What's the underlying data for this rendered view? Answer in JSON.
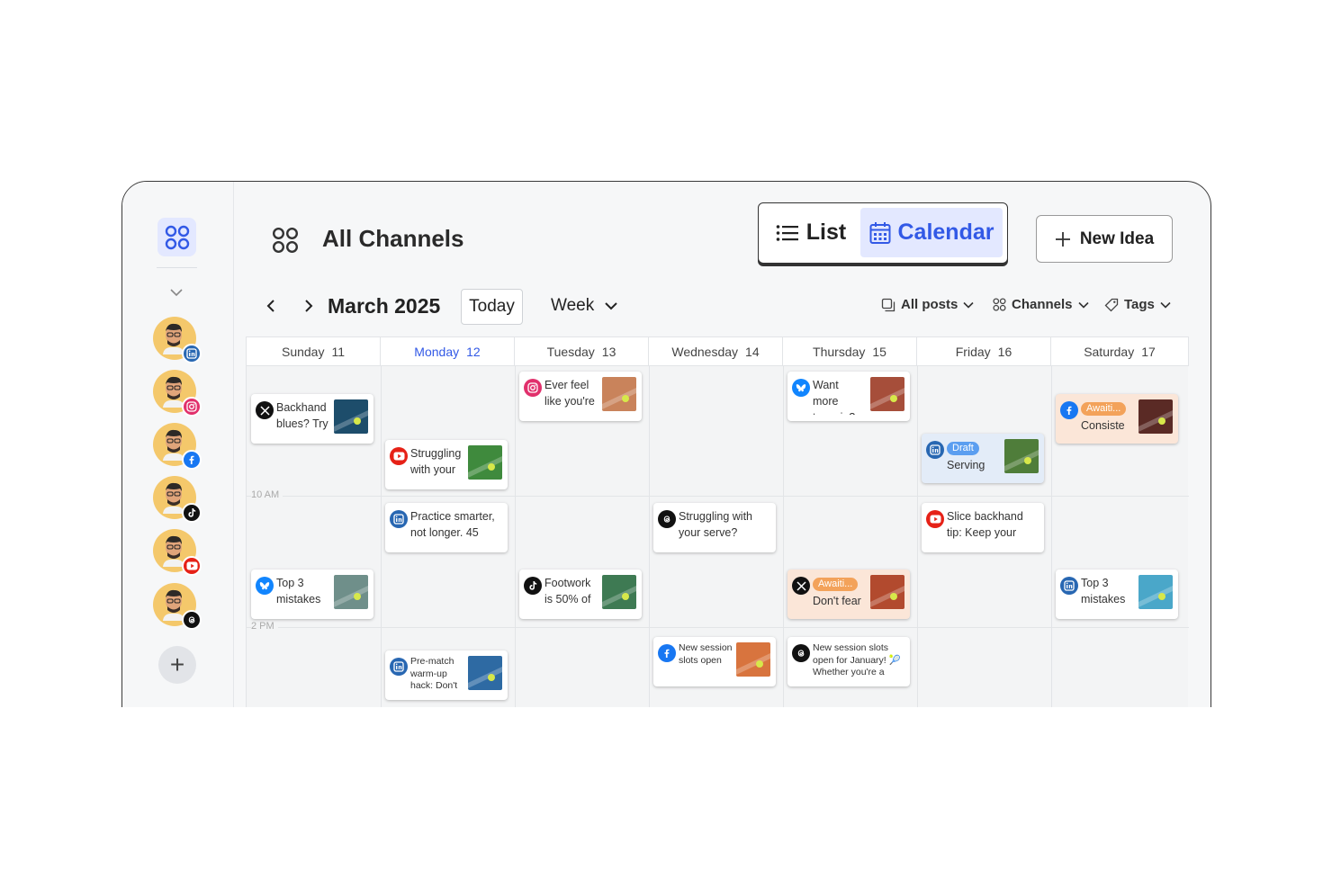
{
  "colors": {
    "accent": "#3259e6",
    "linkedin": "#2867b2",
    "instagram": "#e1306c",
    "facebook": "#1877f2",
    "tiktok": "#111111",
    "youtube": "#e62117",
    "threads": "#111111",
    "bluesky": "#1185fe",
    "x": "#111111"
  },
  "sidebar": {
    "grid_icon": "grid-icon",
    "collapse_icon": "chevron-down-icon",
    "accounts": [
      {
        "network": "linkedin",
        "badge_icon": "linkedin-icon"
      },
      {
        "network": "instagram",
        "badge_icon": "instagram-icon"
      },
      {
        "network": "facebook",
        "badge_icon": "facebook-icon"
      },
      {
        "network": "tiktok",
        "badge_icon": "tiktok-icon"
      },
      {
        "network": "youtube",
        "badge_icon": "youtube-icon"
      },
      {
        "network": "threads",
        "badge_icon": "threads-icon"
      }
    ],
    "add_label": "+"
  },
  "header": {
    "title": "All Channels",
    "view_list_label": "List",
    "view_calendar_label": "Calendar",
    "new_idea_label": "New Idea"
  },
  "toolbar": {
    "month": "March 2025",
    "today_label": "Today",
    "range_label": "Week",
    "filters": {
      "posts": "All posts",
      "channels": "Channels",
      "tags": "Tags"
    }
  },
  "calendar": {
    "days": [
      {
        "name": "Sunday",
        "date": "11"
      },
      {
        "name": "Monday",
        "date": "12",
        "active": true
      },
      {
        "name": "Tuesday",
        "date": "13"
      },
      {
        "name": "Wednesday",
        "date": "14"
      },
      {
        "name": "Thursday",
        "date": "15"
      },
      {
        "name": "Friday",
        "date": "16"
      },
      {
        "name": "Saturday",
        "date": "17"
      }
    ],
    "time_labels": [
      "10 AM",
      "2 PM"
    ],
    "posts": [
      {
        "day": 0,
        "slot": "a",
        "network": "x",
        "text": "Backhand blues? Try",
        "thumb": "#1d4d6b"
      },
      {
        "day": 1,
        "slot": "b",
        "network": "youtube",
        "text": "Struggling with your",
        "thumb": "#3f8a3d"
      },
      {
        "day": 2,
        "slot": "top",
        "network": "instagram",
        "text": "Ever feel like you're",
        "thumb": "#c9835b"
      },
      {
        "day": 4,
        "slot": "top",
        "network": "bluesky",
        "text": "Want more topspin?",
        "thumb": "#a64e3a"
      },
      {
        "day": 6,
        "slot": "a",
        "network": "facebook",
        "status": "Awaiti...",
        "text": "Consiste",
        "thumb": "#5a2a25",
        "style": "await"
      },
      {
        "day": 5,
        "slot": "c",
        "network": "linkedin",
        "status": "Draft",
        "text": "Serving",
        "thumb": "#4f7d3a",
        "style": "draft"
      },
      {
        "day": 1,
        "slot": "d",
        "network": "linkedin",
        "text": "Practice smarter, not longer. 45",
        "thumb": ""
      },
      {
        "day": 3,
        "slot": "d",
        "network": "threads",
        "text": "Struggling with your serve?",
        "thumb": ""
      },
      {
        "day": 5,
        "slot": "d",
        "network": "youtube",
        "text": "Slice backhand tip: Keep your",
        "thumb": ""
      },
      {
        "day": 0,
        "slot": "e",
        "network": "bluesky",
        "text": "Top 3 mistakes",
        "thumb": "#6f8f8a"
      },
      {
        "day": 2,
        "slot": "e",
        "network": "tiktok",
        "text": "Footwork is 50% of",
        "thumb": "#3e7a53"
      },
      {
        "day": 4,
        "slot": "e",
        "network": "x",
        "status": "Awaiti...",
        "text": "Don't fear",
        "thumb": "#b24a2e",
        "style": "await"
      },
      {
        "day": 6,
        "slot": "e",
        "network": "linkedin",
        "text": "Top 3 mistakes",
        "thumb": "#4aa7c9"
      },
      {
        "day": 1,
        "slot": "f",
        "network": "linkedin",
        "text": "Pre-match warm-up hack: Don't",
        "thumb": "#2e6aa3",
        "small": true
      },
      {
        "day": 3,
        "slot": "g",
        "network": "facebook",
        "text": "New session slots open",
        "thumb": "#d8743e",
        "small": true
      },
      {
        "day": 4,
        "slot": "g",
        "network": "threads",
        "text": "New session slots open for January! 🎾 Whether you're a",
        "thumb": "",
        "small": true
      }
    ]
  }
}
